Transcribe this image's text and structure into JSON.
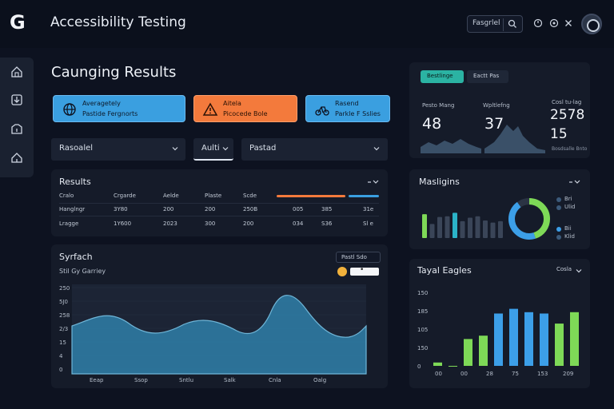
{
  "app": {
    "logo": "G",
    "title": "Accessibility Testing"
  },
  "topbar": {
    "search_text": "Fasgrlel"
  },
  "section_title": "Caunging Results",
  "cards": [
    {
      "line1": "Averagetely",
      "line2": "Pastide Fergnorts",
      "color": "#3a9fe0"
    },
    {
      "line1": "Aitela",
      "line2": "Picocede Bole",
      "color": "#f37a3c"
    },
    {
      "line1": "Rasend",
      "line2": "Parkle F Sslies",
      "color": "#3a9fe0"
    }
  ],
  "filters": [
    {
      "label": "Rasoalel"
    },
    {
      "label": "Aulti"
    },
    {
      "label": "Pastad"
    }
  ],
  "metrics": {
    "tabs": [
      "Bestlinge",
      "Eactt Pas"
    ],
    "stats": [
      {
        "label": "Pesto Mang",
        "value": "48"
      },
      {
        "label": "Wpltlefng",
        "value": "37"
      }
    ],
    "side_label": "Cosl tu-lag",
    "side_value_1": "2578",
    "side_value_2": "15",
    "side_caption": "Bosdsalle Bnto"
  },
  "results": {
    "title": "Results",
    "headers": [
      "Cralo",
      "Crgarde",
      "Aelde",
      "Plaste",
      "Scde"
    ],
    "rows": [
      [
        "Hanglngr",
        "3Y80",
        "200",
        "200",
        "250B",
        "005",
        "385",
        "31e"
      ],
      [
        "Lragge",
        "1Y600",
        "2023",
        "300",
        "200",
        "034",
        "S36",
        "Sl e"
      ]
    ]
  },
  "synfach": {
    "title": "Syrfach",
    "subtitle": "Stil Gy Garriey",
    "dropdown": "Pastl Sdo",
    "toggle_label": "•",
    "y_labels": [
      "250",
      "5J0",
      "258",
      "2/3",
      "15",
      "4",
      "0"
    ],
    "x_labels": [
      "Eeap",
      "Ssop",
      "Sntlu",
      "Salk",
      "Cnla",
      "Oalg"
    ],
    "area_color": "#2f7fa8"
  },
  "margins": {
    "title": "Masligins",
    "legend": [
      "Bri",
      "Ulid",
      "Bii",
      "Klid"
    ],
    "bars": [
      0.68,
      0.4,
      0.6,
      0.62,
      0.72,
      0.48,
      0.58,
      0.62,
      0.5,
      0.44,
      0.48
    ],
    "bar_highlight_index": [
      0,
      4
    ],
    "donut": [
      {
        "value": 0.45,
        "color": "#7ed957"
      },
      {
        "value": 0.45,
        "color": "#3c9fe8"
      },
      {
        "value": 0.1,
        "color": "#2b3444"
      }
    ]
  },
  "traffic": {
    "title": "Tayal Eagles",
    "dropdown": "Cosla",
    "y_labels": [
      "150",
      "185",
      "105",
      "150",
      "0"
    ],
    "x_labels": [
      "00",
      "00",
      "28",
      "75",
      "153",
      "209"
    ],
    "values": [
      0.05,
      0.0,
      0.4,
      0.45,
      0.78,
      0.85,
      0.8,
      0.78,
      0.63,
      0.8
    ],
    "colors": [
      "#7ed957",
      "#7ed957",
      "#7ed957",
      "#7ed957",
      "#3c9fe8",
      "#3c9fe8",
      "#3c9fe8",
      "#3c9fe8",
      "#7ed957",
      "#7ed957"
    ]
  },
  "colors": {
    "accent_teal": "#2bb3a3",
    "accent_orange": "#f37a3c",
    "accent_blue": "#3a9fe0",
    "accent_green": "#7ed957"
  }
}
